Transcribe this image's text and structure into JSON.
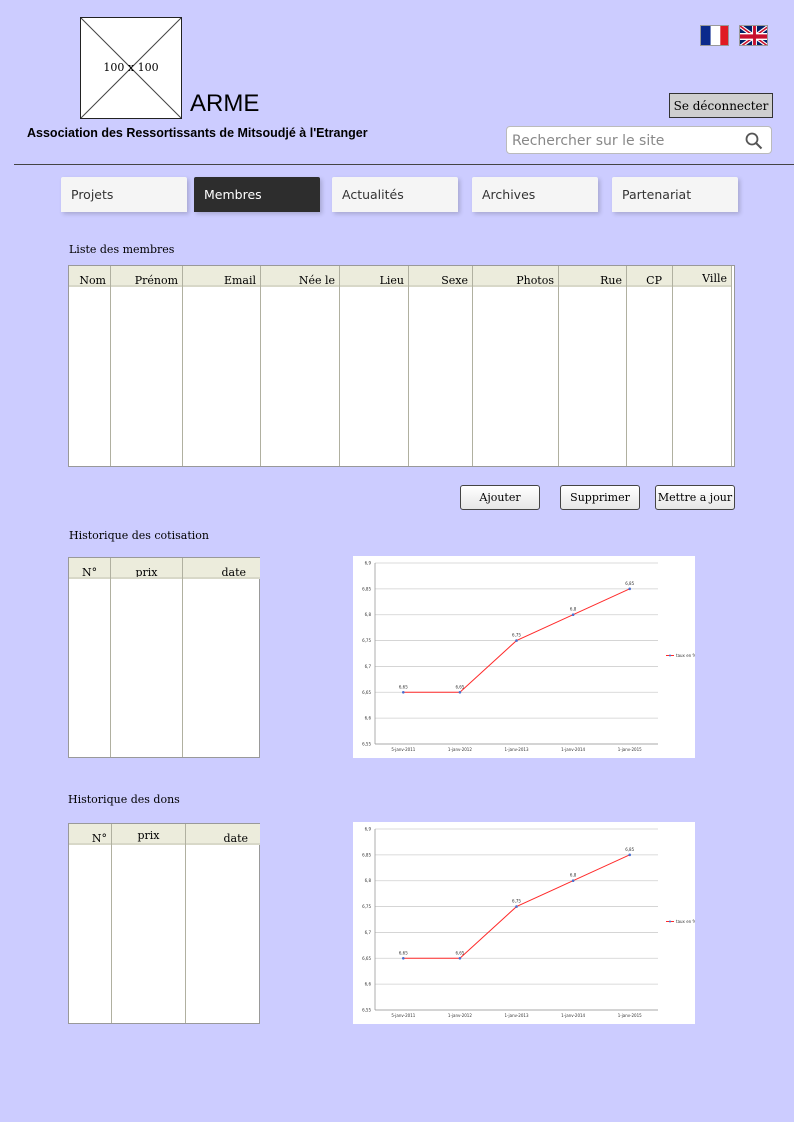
{
  "header": {
    "logo_placeholder": "100 x 100",
    "site_name": "ARME",
    "tagline": "Association des Ressortissants de Mitsoudjé à l'Etranger",
    "logout_label": "Se déconnecter",
    "search_placeholder": "Rechercher sur le site",
    "languages": [
      "fr-flag-icon",
      "uk-flag-icon"
    ]
  },
  "nav": {
    "tabs": [
      "Projets",
      "Membres",
      "Actualités",
      "Archives",
      "Partenariat"
    ],
    "active_tab": "Membres"
  },
  "members": {
    "title": "Liste des membres",
    "columns": [
      "Nom",
      "Prénom",
      "Email",
      "Née le",
      "Lieu",
      "Sexe",
      "Photos",
      "Rue",
      "CP",
      "Ville"
    ],
    "rows": []
  },
  "actions": {
    "add_label": "Ajouter",
    "delete_label": "Supprimer",
    "update_label": "Mettre a jour"
  },
  "cotisations": {
    "title": "Historique des cotisation",
    "columns": [
      "N°",
      "prix",
      "date"
    ],
    "rows": []
  },
  "dons": {
    "title": "Historique des dons",
    "columns": [
      "N°",
      "prix",
      "date"
    ],
    "rows": []
  },
  "colors": {
    "page_background": "#ccccff",
    "active_tab": "#2d2d2d",
    "chart_line": "#ff2a2a"
  },
  "chart_data": [
    {
      "type": "line",
      "categories": [
        "5-janv-2011",
        "1-janv-2012",
        "1-janv-2013",
        "1-janv-2014",
        "1-janv-2015"
      ],
      "series": [
        {
          "name": "taux en %",
          "values": [
            6.65,
            6.65,
            6.75,
            6.8,
            6.85
          ],
          "data_labels": [
            "6,65",
            "6,65",
            "6,75",
            "6,8",
            "6,85"
          ]
        }
      ],
      "y_ticks": [
        "6,55",
        "6,6",
        "6,65",
        "6,7",
        "6,75",
        "6,8",
        "6,85",
        "6,9"
      ],
      "ylim": [
        6.55,
        6.9
      ],
      "grid": true,
      "legend": "right"
    },
    {
      "type": "line",
      "categories": [
        "5-janv-2011",
        "1-janv-2012",
        "1-janv-2013",
        "1-janv-2014",
        "1-janv-2015"
      ],
      "series": [
        {
          "name": "taux en %",
          "values": [
            6.65,
            6.65,
            6.75,
            6.8,
            6.85
          ],
          "data_labels": [
            "6,65",
            "6,65",
            "6,75",
            "6,8",
            "6,85"
          ]
        }
      ],
      "y_ticks": [
        "6,55",
        "6,6",
        "6,65",
        "6,7",
        "6,75",
        "6,8",
        "6,85",
        "6,9"
      ],
      "ylim": [
        6.55,
        6.9
      ],
      "grid": true,
      "legend": "right"
    }
  ]
}
